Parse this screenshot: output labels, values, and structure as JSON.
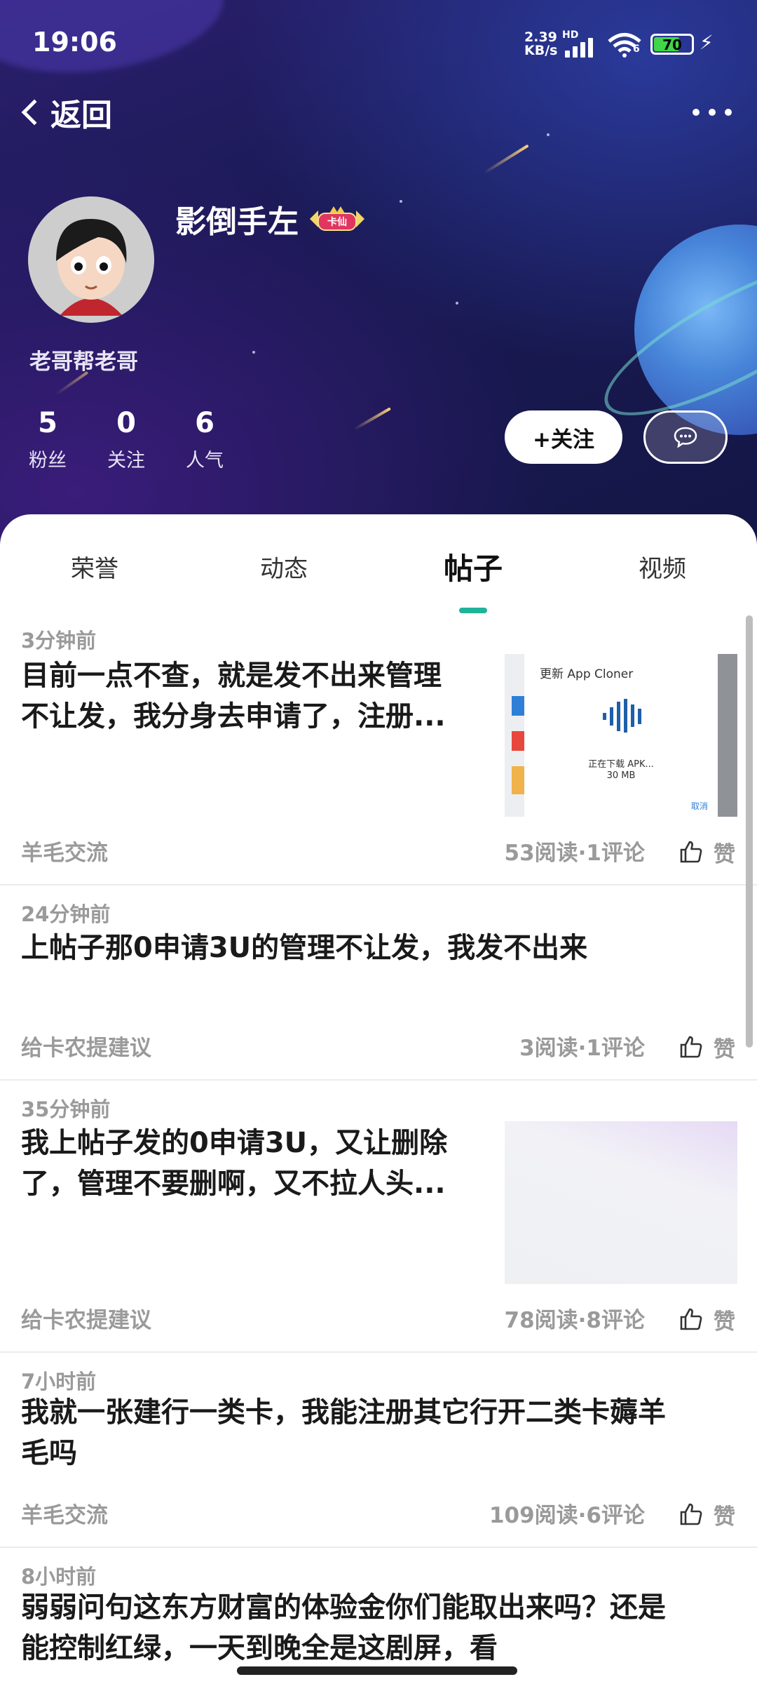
{
  "status_bar": {
    "time": "19:06",
    "net_speed_value": "2.39",
    "net_speed_unit": "KB/s",
    "hd_label": "HD",
    "wifi_label": "6",
    "battery_level": "70",
    "battery_fraction": 0.7
  },
  "nav": {
    "back_label": "返回"
  },
  "profile": {
    "nickname": "影倒手左",
    "badge_label": "卡仙",
    "signature": "老哥帮老哥",
    "stats": [
      {
        "value": "5",
        "label": "粉丝"
      },
      {
        "value": "0",
        "label": "关注"
      },
      {
        "value": "6",
        "label": "人气"
      }
    ],
    "follow_button": "+关注"
  },
  "tabs": [
    {
      "label": "荣誉",
      "active": false
    },
    {
      "label": "动态",
      "active": false
    },
    {
      "label": "帖子",
      "active": true
    },
    {
      "label": "视频",
      "active": false
    }
  ],
  "posts": [
    {
      "time": "3分钟前",
      "title_line1": "目前一点不查，就是发不出来管理",
      "title_line2": "不让发，我分身去申请了，注册...",
      "category": "羊毛交流",
      "stats": "53阅读·1评论",
      "like_label": "赞",
      "thumbnail": {
        "title": "更新 App Cloner",
        "status": "正在下载 APK...",
        "size": "30 MB",
        "cancel": "取消"
      }
    },
    {
      "time": "24分钟前",
      "title_line1": "上帖子那0申请3U的管理不让发，我发不出来",
      "category": "给卡农提建议",
      "stats": "3阅读·1评论",
      "like_label": "赞"
    },
    {
      "time": "35分钟前",
      "title_line1": "我上帖子发的0申请3U，又让删除",
      "title_line2": "了，管理不要删啊，又不拉人头...",
      "category": "给卡农提建议",
      "stats": "78阅读·8评论",
      "like_label": "赞"
    },
    {
      "time": "7小时前",
      "title_line1": "我就一张建行一类卡，我能注册其它行开二类卡薅羊",
      "title_line2": "毛吗",
      "category": "羊毛交流",
      "stats": "109阅读·6评论",
      "like_label": "赞"
    },
    {
      "time": "8小时前",
      "title_line1": "弱弱问句这东方财富的体验金你们能取出来吗？还是",
      "title_line2": "能控制红绿，一天到晚全是这剧屏，看"
    }
  ],
  "icons": {
    "back": "chevron-left-icon",
    "more": "more-dots-icon",
    "message": "chat-bubble-icon",
    "like": "thumbs-up-icon"
  },
  "colors": {
    "accent": "#1fb39a",
    "header_bg": "#1a1a55"
  }
}
